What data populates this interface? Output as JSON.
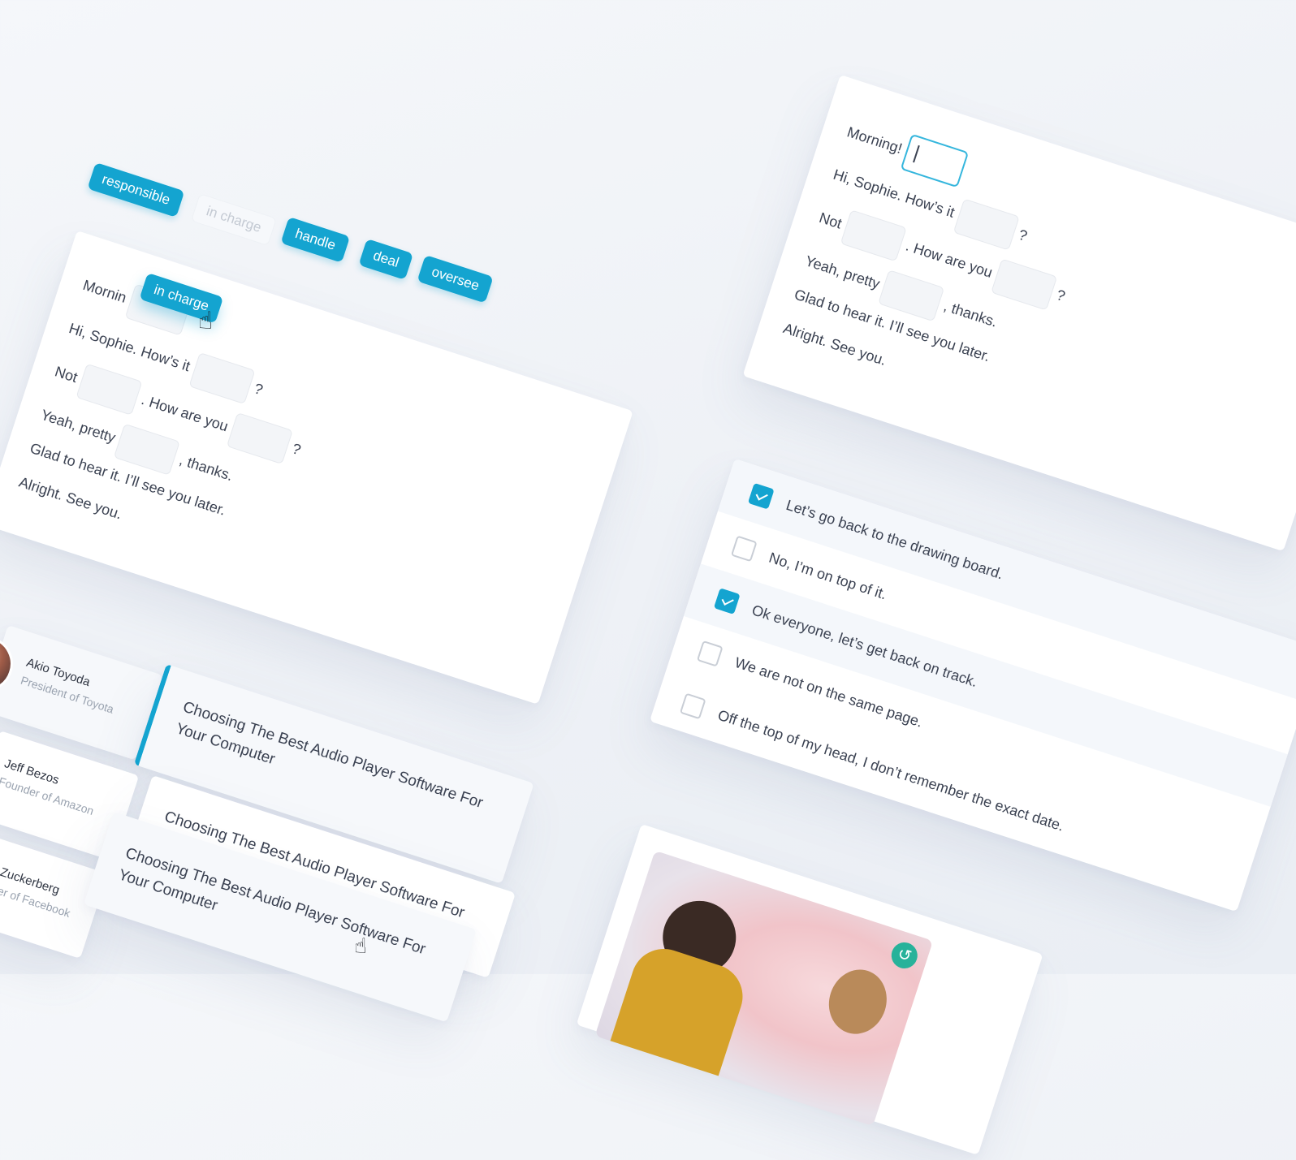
{
  "word_bank": {
    "chips": [
      {
        "label": "responsible",
        "state": "filled"
      },
      {
        "label": "in charge",
        "state": "used"
      },
      {
        "label": "handle",
        "state": "filled"
      },
      {
        "label": "deal",
        "state": "filled"
      },
      {
        "label": "oversee",
        "state": "filled"
      }
    ],
    "dragging_chip": "in charge"
  },
  "dialogue_left": {
    "line1": "Mornin",
    "line2_a": "Hi, Sophie. How’s it",
    "line2_b": "?",
    "line3_a": "Not",
    "line3_b": ". How are you",
    "line3_c": "?",
    "line4_a": "Yeah, pretty",
    "line4_b": ", thanks.",
    "line5": "Glad to hear it. I’ll see you later.",
    "line6": "Alright. See you."
  },
  "dialogue_right": {
    "line1": "Morning!",
    "line2_a": "Hi, Sophie. How’s it",
    "line2_b": "?",
    "line3_a": "Not",
    "line3_b": ". How are you",
    "line3_c": "?",
    "line4_a": "Yeah, pretty",
    "line4_b": ", thanks.",
    "line5": "Glad to hear it. I’ll see you later.",
    "line6": "Alright. See you."
  },
  "checklist": [
    {
      "label": "Let’s go back to the drawing board.",
      "checked": true
    },
    {
      "label": "No, I’m on top of it.",
      "checked": false
    },
    {
      "label": "Ok everyone, let’s get back on track.",
      "checked": true
    },
    {
      "label": "We are not on the same page.",
      "checked": false
    },
    {
      "label": "Off the top of my head, I don’t remember the exact date.",
      "checked": false
    }
  ],
  "quotes": [
    {
      "name": "Akio Toyoda",
      "role": "President of Toyota",
      "article": "Choosing The Best Audio Player Software For Your Computer"
    },
    {
      "name": "Jeff Bezos",
      "role": "Founder of Amazon",
      "article": "Choosing The Best Audio Player Software For Your"
    },
    {
      "name": "k Zuckerberg",
      "role": "nder of Facebook",
      "article": "Choosing The Best Audio Player Software For Your Computer"
    }
  ],
  "colors": {
    "accent": "#14a4d0",
    "background": "#f1f4f8",
    "text": "#3b4252"
  },
  "icons": {
    "refresh": "refresh-icon",
    "cursor": "hand-cursor-icon"
  }
}
